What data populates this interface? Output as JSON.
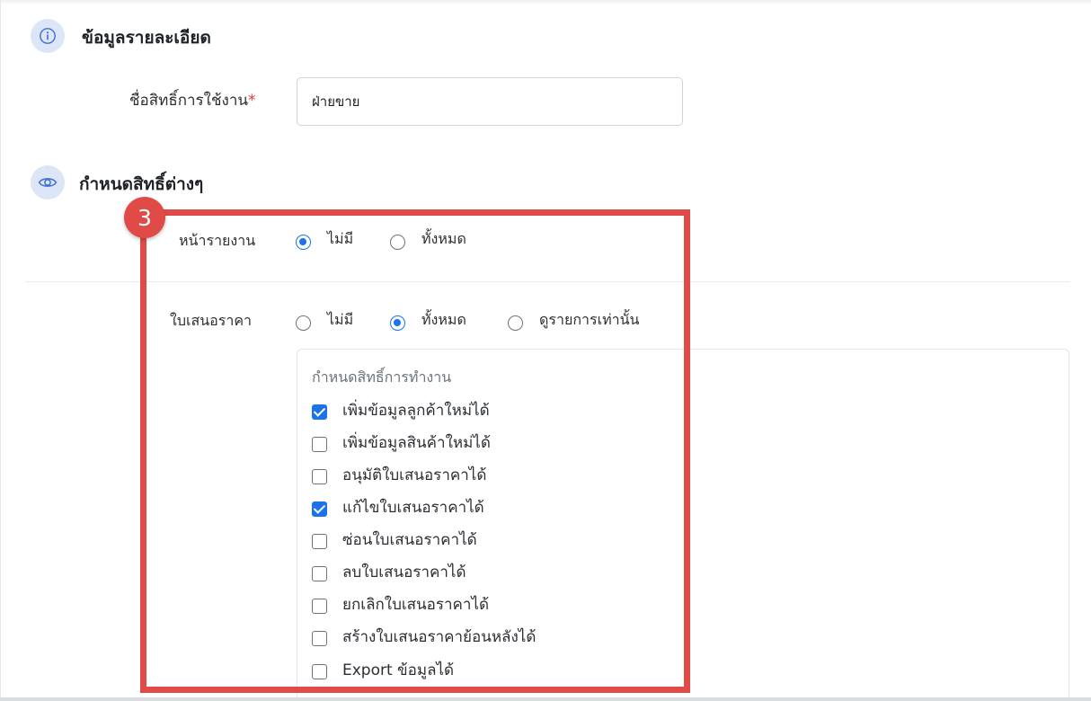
{
  "details_section": {
    "title": "ข้อมูลรายละเอียด",
    "icon": "info-icon",
    "name_label": "ชื่อสิทธิ์การใช้งาน",
    "required_mark": "*",
    "name_value": "ฝ่ายขาย"
  },
  "permissions_section": {
    "title": "กำหนดสิทธิ์ต่างๆ",
    "icon": "eye-icon"
  },
  "report_row": {
    "label": "หน้ารายงาน",
    "options": [
      {
        "label": "ไม่มี",
        "selected": true
      },
      {
        "label": "ทั้งหมด",
        "selected": false
      }
    ]
  },
  "quotation_row": {
    "label": "ใบเสนอราคา",
    "options": [
      {
        "label": "ไม่มี",
        "selected": false
      },
      {
        "label": "ทั้งหมด",
        "selected": true
      },
      {
        "label": "ดูรายการเท่านั้น",
        "selected": false
      }
    ],
    "permissions_heading": "กำหนดสิทธิ์การทำงาน",
    "permissions": [
      {
        "label": "เพิ่มข้อมูลลูกค้าใหม่ได้",
        "checked": true
      },
      {
        "label": "เพิ่มข้อมูลสินค้าใหม่ได้",
        "checked": false
      },
      {
        "label": "อนุมัติใบเสนอราคาได้",
        "checked": false
      },
      {
        "label": "แก้ไขใบเสนอราคาได้",
        "checked": true
      },
      {
        "label": "ซ่อนใบเสนอราคาได้",
        "checked": false
      },
      {
        "label": "ลบใบเสนอราคาได้",
        "checked": false
      },
      {
        "label": "ยกเลิกใบเสนอราคาได้",
        "checked": false
      },
      {
        "label": "สร้างใบเสนอราคาย้อนหลังได้",
        "checked": false
      },
      {
        "label": "Export ข้อมูลได้",
        "checked": false
      }
    ]
  },
  "annotation": {
    "step_number": "3",
    "color": "#e04b48"
  },
  "colors": {
    "accent": "#1a73e8",
    "icon_bg": "#dde6f6"
  }
}
